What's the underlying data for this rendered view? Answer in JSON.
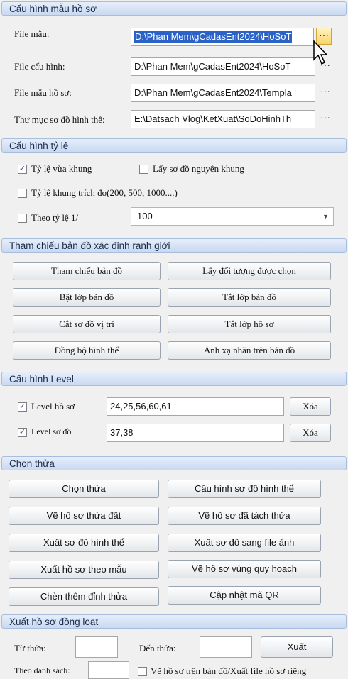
{
  "s1": {
    "title": "Cấu hình mẫu hồ sơ",
    "rows": [
      {
        "label": "File mẫu:",
        "value": "D:\\Phan Mem\\gCadasEnt2024\\HoSoT"
      },
      {
        "label": "File cấu hình:",
        "value": "D:\\Phan Mem\\gCadasEnt2024\\HoSoT"
      },
      {
        "label": "File mẫu hồ sơ:",
        "value": "D:\\Phan Mem\\gCadasEnt2024\\Templa"
      },
      {
        "label": "Thư mục sơ đồ hình thể:",
        "value": "E:\\Datsach Vlog\\KetXuat\\SoDoHinhTh"
      }
    ],
    "browse": "···"
  },
  "s2": {
    "title": "Cấu hình tỷ lệ",
    "fit_frame": "Tỷ lệ vừa khung",
    "original_frame": "Lấy sơ đồ nguyên khung",
    "scale_extract": "Tỷ lệ khung trích đo(200, 500, 1000....)",
    "by_scale": "Theo tỷ lệ 1/",
    "scale_value": "100"
  },
  "s3": {
    "title": "Tham chiếu bản đồ xác định ranh giới",
    "buttons": [
      "Tham chiếu bản đồ",
      "Lấy đối tượng được chọn",
      "Bật lớp bản đồ",
      "Tắt lớp bản đồ",
      "Cắt sơ đồ vị trí",
      "Tắt lớp hồ sơ",
      "Đồng bộ hình thể",
      "Ánh xạ nhãn trên bản đồ"
    ]
  },
  "s4": {
    "title": "Cấu hình Level",
    "level_file_label": "Level hồ sơ",
    "level_file_value": "24,25,56,60,61",
    "level_map_label": "Level sơ đồ",
    "level_map_value": "37,38",
    "delete": "Xóa"
  },
  "s5": {
    "title": "Chọn thửa",
    "buttons": [
      "Chọn thửa",
      "Cấu hình sơ đồ hình thể",
      "Vẽ hồ sơ thửa đất",
      "Vẽ hồ sơ đã tách thửa",
      "Xuất sơ đồ hình thể",
      "Xuất sơ đồ sang file ảnh",
      "Xuất hồ sơ theo mẫu",
      "Vẽ hồ sơ vùng quy hoạch",
      "Chèn thêm đỉnh thửa",
      "Cập nhật mã QR"
    ]
  },
  "s6": {
    "title": "Xuất hồ sơ đồng loạt",
    "from_label": "Từ thửa:",
    "to_label": "Đến thửa:",
    "export": "Xuất",
    "by_list": "Theo danh sách:",
    "draw_on_map": "Vẽ hồ sơ trên bản đồ/Xuất file hồ sơ riêng"
  },
  "colors": {
    "header_top": "#e6eefb",
    "header_bottom": "#c9d9f1",
    "selection": "#2a62c8",
    "browse_hot": "#f8d46a"
  }
}
